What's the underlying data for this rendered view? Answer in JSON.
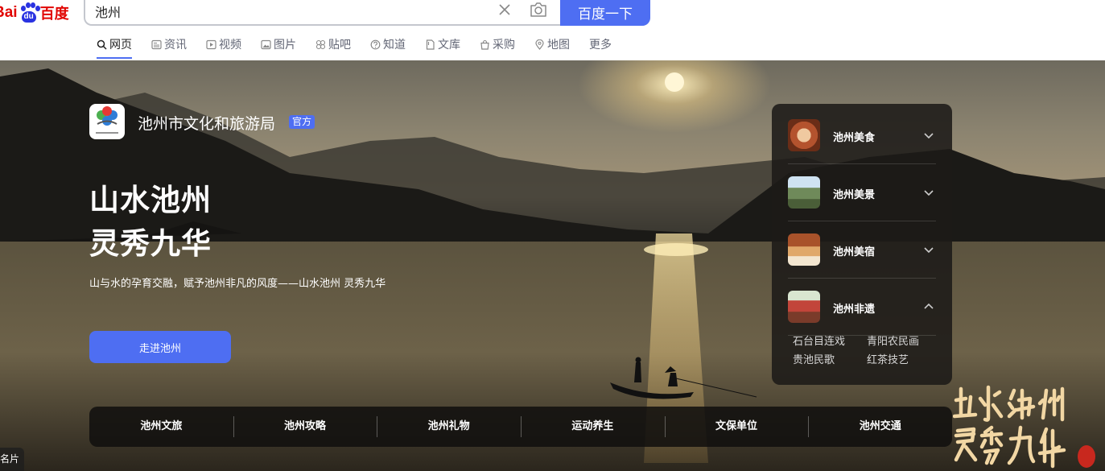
{
  "search": {
    "query": "池州",
    "button_label": "百度一下"
  },
  "tabs": [
    {
      "label": "网页",
      "icon": "search-icon"
    },
    {
      "label": "资讯",
      "icon": "news-icon"
    },
    {
      "label": "视频",
      "icon": "video-icon"
    },
    {
      "label": "图片",
      "icon": "image-icon"
    },
    {
      "label": "贴吧",
      "icon": "tieba-icon"
    },
    {
      "label": "知道",
      "icon": "question-icon"
    },
    {
      "label": "文库",
      "icon": "document-icon"
    },
    {
      "label": "采购",
      "icon": "bag-icon"
    },
    {
      "label": "地图",
      "icon": "map-icon"
    },
    {
      "label": "更多",
      "icon": ""
    }
  ],
  "hero": {
    "org_name": "池州市文化和旅游局",
    "official_badge": "官方",
    "headline_line1": "山水池州",
    "headline_line2": "灵秀九华",
    "subtitle": "山与水的孕育交融，赋予池州非凡的风度——山水池州 灵秀九华",
    "cta_label": "走进池州",
    "corner_tag": "名片",
    "calligraphy_text": "山水池州灵秀九华"
  },
  "panel": {
    "items": [
      {
        "label": "池州美食",
        "expanded": false
      },
      {
        "label": "池州美景",
        "expanded": false
      },
      {
        "label": "池州美宿",
        "expanded": false
      },
      {
        "label": "池州非遗",
        "expanded": true
      }
    ],
    "sub_items": [
      "石台目连戏",
      "青阳农民画",
      "贵池民歌",
      "红茶技艺"
    ]
  },
  "bottom_nav": [
    "池州文旅",
    "池州攻略",
    "池州礼物",
    "运动养生",
    "文保单位",
    "池州交通"
  ],
  "colors": {
    "accent": "#4e6ef2",
    "logo_red": "#e10602",
    "logo_blue": "#2932e1"
  }
}
